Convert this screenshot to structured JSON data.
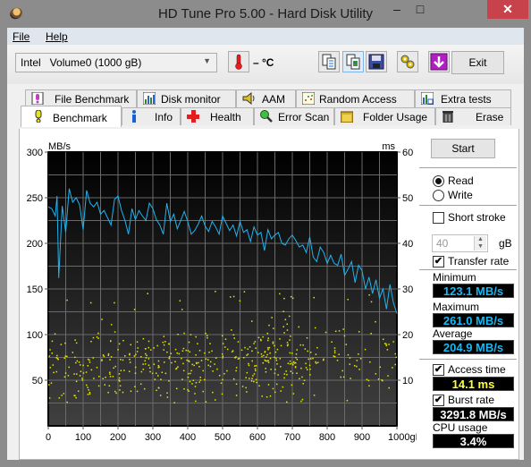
{
  "window": {
    "title": "HD Tune Pro 5.00 - Hard Disk Utility",
    "minimize_glyph": "‒",
    "maximize_glyph": "□",
    "close_glyph": "✕"
  },
  "menu": {
    "file": "File",
    "help": "Help"
  },
  "toolbar": {
    "drive_select": "Intel   Volume0 (1000 gB)",
    "temperature": "– °C",
    "icons": [
      "copy-text-icon",
      "copy-screenshot-icon",
      "save-icon",
      "options-icon",
      "download-icon"
    ],
    "exit_label": "Exit"
  },
  "tabs": {
    "top_row": [
      {
        "label": "File Benchmark",
        "icon": "file-benchmark-icon"
      },
      {
        "label": "Disk monitor",
        "icon": "disk-monitor-icon"
      },
      {
        "label": "AAM",
        "icon": "speaker-icon"
      },
      {
        "label": "Random Access",
        "icon": "random-access-icon"
      },
      {
        "label": "Extra tests",
        "icon": "extra-tests-icon"
      }
    ],
    "bottom_row": [
      {
        "label": "Benchmark",
        "icon": "benchmark-icon",
        "selected": true
      },
      {
        "label": "Info",
        "icon": "info-icon"
      },
      {
        "label": "Health",
        "icon": "health-cross-icon"
      },
      {
        "label": "Error Scan",
        "icon": "magnifier-icon"
      },
      {
        "label": "Folder Usage",
        "icon": "folder-icon"
      },
      {
        "label": "Erase",
        "icon": "trash-icon"
      }
    ]
  },
  "side": {
    "start_label": "Start",
    "read_label": "Read",
    "write_label": "Write",
    "mode_selected": "Read",
    "short_stroke_label": "Short stroke",
    "short_stroke_checked": false,
    "short_stroke_value": "40",
    "short_stroke_unit": "gB",
    "transfer_rate_label": "Transfer rate",
    "transfer_rate_checked": true,
    "minimum_label": "Minimum",
    "minimum_value": "123.1 MB/s",
    "maximum_label": "Maximum",
    "maximum_value": "261.0 MB/s",
    "average_label": "Average",
    "average_value": "204.9 MB/s",
    "access_time_label": "Access time",
    "access_time_checked": true,
    "access_time_value": "14.1 ms",
    "burst_rate_label": "Burst rate",
    "burst_rate_checked": true,
    "burst_rate_value": "3291.8 MB/s",
    "cpu_usage_label": "CPU usage",
    "cpu_usage_value": "3.4%"
  },
  "chart_data": {
    "type": "line",
    "title": "",
    "xlabel": "gB",
    "ylabel_left": "MB/s",
    "ylabel_right": "ms",
    "xlim": [
      0,
      1000
    ],
    "ylim_left": [
      0,
      300
    ],
    "ylim_right": [
      0,
      60
    ],
    "x_ticks": [
      "0",
      "100",
      "200",
      "300",
      "400",
      "500",
      "600",
      "700",
      "800",
      "900",
      "1000gB"
    ],
    "y_ticks_left": [
      "300",
      "250",
      "200",
      "150",
      "100",
      "50"
    ],
    "y_ticks_right": [
      "60",
      "50",
      "40",
      "30",
      "20",
      "10"
    ],
    "grid": true,
    "series": [
      {
        "name": "Transfer rate",
        "axis": "left",
        "color": "#1fb4f0",
        "x": [
          0,
          10,
          20,
          25,
          30,
          40,
          50,
          60,
          70,
          80,
          90,
          100,
          110,
          120,
          130,
          140,
          150,
          160,
          170,
          180,
          190,
          200,
          210,
          220,
          230,
          240,
          250,
          260,
          270,
          280,
          290,
          300,
          310,
          320,
          330,
          340,
          350,
          360,
          370,
          380,
          390,
          400,
          410,
          420,
          430,
          440,
          450,
          460,
          470,
          480,
          490,
          500,
          510,
          520,
          530,
          540,
          550,
          560,
          570,
          580,
          590,
          600,
          610,
          620,
          630,
          640,
          650,
          660,
          670,
          680,
          690,
          700,
          710,
          720,
          730,
          740,
          750,
          760,
          770,
          780,
          790,
          800,
          810,
          820,
          830,
          840,
          850,
          860,
          870,
          880,
          890,
          900,
          910,
          920,
          930,
          940,
          950,
          960,
          970,
          980,
          990,
          1000
        ],
        "values": [
          240,
          238,
          230,
          252,
          162,
          241,
          212,
          260,
          245,
          250,
          242,
          215,
          258,
          244,
          240,
          245,
          232,
          236,
          228,
          220,
          248,
          252,
          236,
          225,
          210,
          238,
          226,
          236,
          230,
          225,
          244,
          238,
          226,
          220,
          210,
          244,
          224,
          232,
          216,
          225,
          235,
          224,
          210,
          214,
          221,
          230,
          219,
          213,
          224,
          218,
          210,
          230,
          222,
          214,
          220,
          208,
          224,
          212,
          215,
          202,
          218,
          209,
          212,
          192,
          215,
          205,
          209,
          212,
          200,
          198,
          205,
          209,
          203,
          196,
          198,
          190,
          207,
          185,
          180,
          196,
          190,
          178,
          187,
          178,
          176,
          188,
          165,
          172,
          180,
          157,
          176,
          170,
          150,
          163,
          145,
          160,
          140,
          150,
          128,
          155,
          135,
          123
        ]
      },
      {
        "name": "Access time",
        "axis": "right",
        "type": "scatter",
        "color": "#e8e800",
        "description": "Yellow scatter points mostly between 5 and 25 ms, average 14.1 ms"
      }
    ]
  }
}
